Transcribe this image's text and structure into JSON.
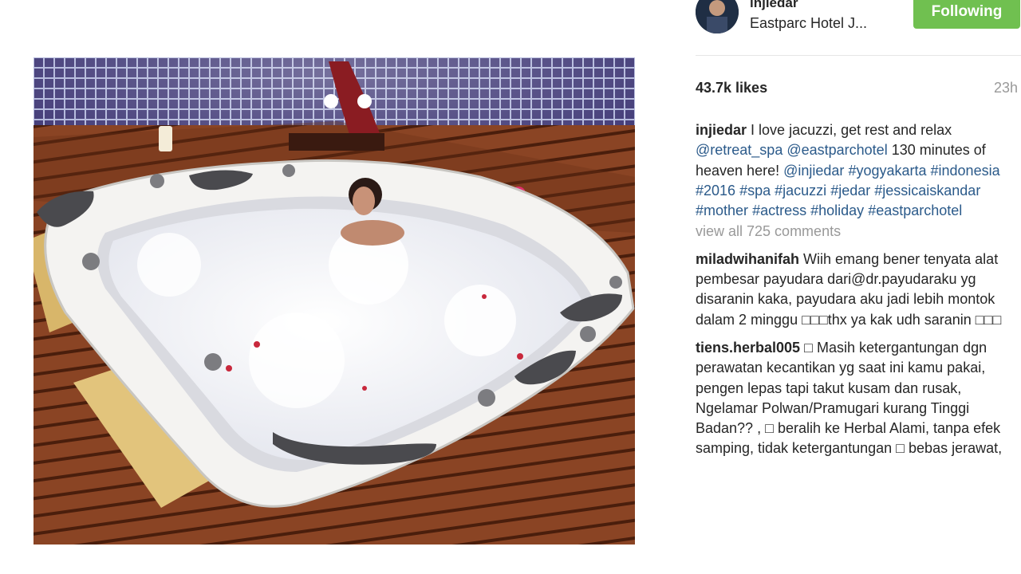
{
  "header": {
    "username": "injiedar",
    "location": "Eastparc Hotel J...",
    "follow_button": "Following"
  },
  "post": {
    "likes": "43.7k likes",
    "time_ago": "23h",
    "caption": {
      "username": "injiedar",
      "text_1": "I love jacuzzi, get rest and relax",
      "mention_1": "@retreat_spa",
      "mention_2": "@eastparchotel",
      "text_2": "130 minutes of heaven here!",
      "mention_3": "@injiedar",
      "hashtags": [
        "#yogyakarta",
        "#indonesia",
        "#2016",
        "#spa",
        "#jacuzzi",
        "#jedar",
        "#jessicaiskandar",
        "#mother",
        "#actress",
        "#holiday",
        "#eastparchotel"
      ]
    },
    "view_all_comments": "view all 725 comments"
  },
  "comments": [
    {
      "username": "miladwihanifah",
      "text": "Wiih emang bener tenyata alat pembesar payudara dari@dr.payudaraku yg disaranin kaka, payudara aku jadi lebih montok dalam 2 minggu □□□thx ya kak udh saranin □□□"
    },
    {
      "username": "tiens.herbal005",
      "text": "□ Masih ketergantungan dgn perawatan kecantikan yg saat ini kamu pakai, pengen lepas tapi takut kusam dan rusak, Ngelamar Polwan/Pramugari kurang Tinggi Badan?? , □ beralih ke Herbal Alami, tanpa efek samping, tidak ketergantungan □ bebas jerawat,"
    }
  ],
  "colors": {
    "follow_green": "#70c050",
    "link_blue": "#2b5a8a",
    "muted_gray": "#999999"
  }
}
